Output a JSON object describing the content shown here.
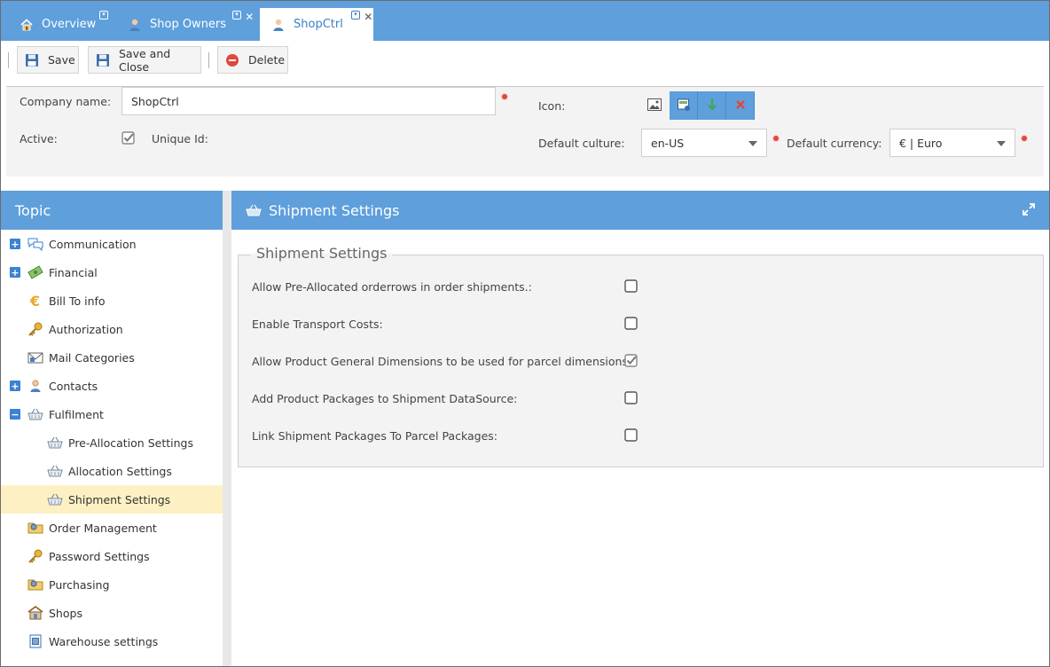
{
  "tabs": [
    {
      "label": "Overview",
      "icon": "home-icon"
    },
    {
      "label": "Shop Owners",
      "icon": "user-icon"
    },
    {
      "label": "ShopCtrl",
      "icon": "user-icon",
      "active": true
    }
  ],
  "toolbar": {
    "save_label": "Save",
    "save_close_label": "Save and Close",
    "delete_label": "Delete"
  },
  "form": {
    "company_name_label": "Company name:",
    "company_name_value": "ShopCtrl",
    "active_label": "Active:",
    "active_checked": true,
    "unique_id_label": "Unique Id:",
    "icon_label": "Icon:",
    "default_culture_label": "Default culture:",
    "default_culture_value": "en-US",
    "default_currency_label": "Default currency:",
    "default_currency_value": "€ | Euro"
  },
  "topic": {
    "title": "Topic",
    "items": [
      {
        "label": "Communication",
        "icon": "chat-icon",
        "expandable": "+"
      },
      {
        "label": "Financial",
        "icon": "money-icon",
        "expandable": "+"
      },
      {
        "label": "Bill To info",
        "icon": "euro-icon"
      },
      {
        "label": "Authorization",
        "icon": "key-icon"
      },
      {
        "label": "Mail Categories",
        "icon": "mail-icon"
      },
      {
        "label": "Contacts",
        "icon": "user-icon",
        "expandable": "+"
      },
      {
        "label": "Fulfilment",
        "icon": "basket-icon",
        "expandable": "−"
      },
      {
        "label": "Pre-Allocation Settings",
        "icon": "basket-icon",
        "child": true
      },
      {
        "label": "Allocation Settings",
        "icon": "basket-icon",
        "child": true
      },
      {
        "label": "Shipment Settings",
        "icon": "basket-icon",
        "child": true,
        "selected": true
      },
      {
        "label": "Order Management",
        "icon": "folder-gear-icon"
      },
      {
        "label": "Password Settings",
        "icon": "key-icon"
      },
      {
        "label": "Purchasing",
        "icon": "folder-gear-icon"
      },
      {
        "label": "Shops",
        "icon": "shop-icon"
      },
      {
        "label": "Warehouse settings",
        "icon": "document-icon"
      }
    ]
  },
  "shipment": {
    "header_title": "Shipment Settings",
    "legend": "Shipment Settings",
    "rows": [
      {
        "label": "Allow Pre-Allocated orderrows in order shipments.:",
        "checked": false
      },
      {
        "label": "Enable Transport Costs:",
        "checked": false
      },
      {
        "label": "Allow Product General Dimensions to be used for parcel dimensions:",
        "checked": true
      },
      {
        "label": "Add Product Packages to Shipment DataSource:",
        "checked": false
      },
      {
        "label": "Link Shipment Packages To Parcel Packages:",
        "checked": false
      }
    ]
  },
  "colors": {
    "accent": "#5e9fdc",
    "selected_row": "#fdf1c3",
    "required_dot": "#e0483c"
  }
}
